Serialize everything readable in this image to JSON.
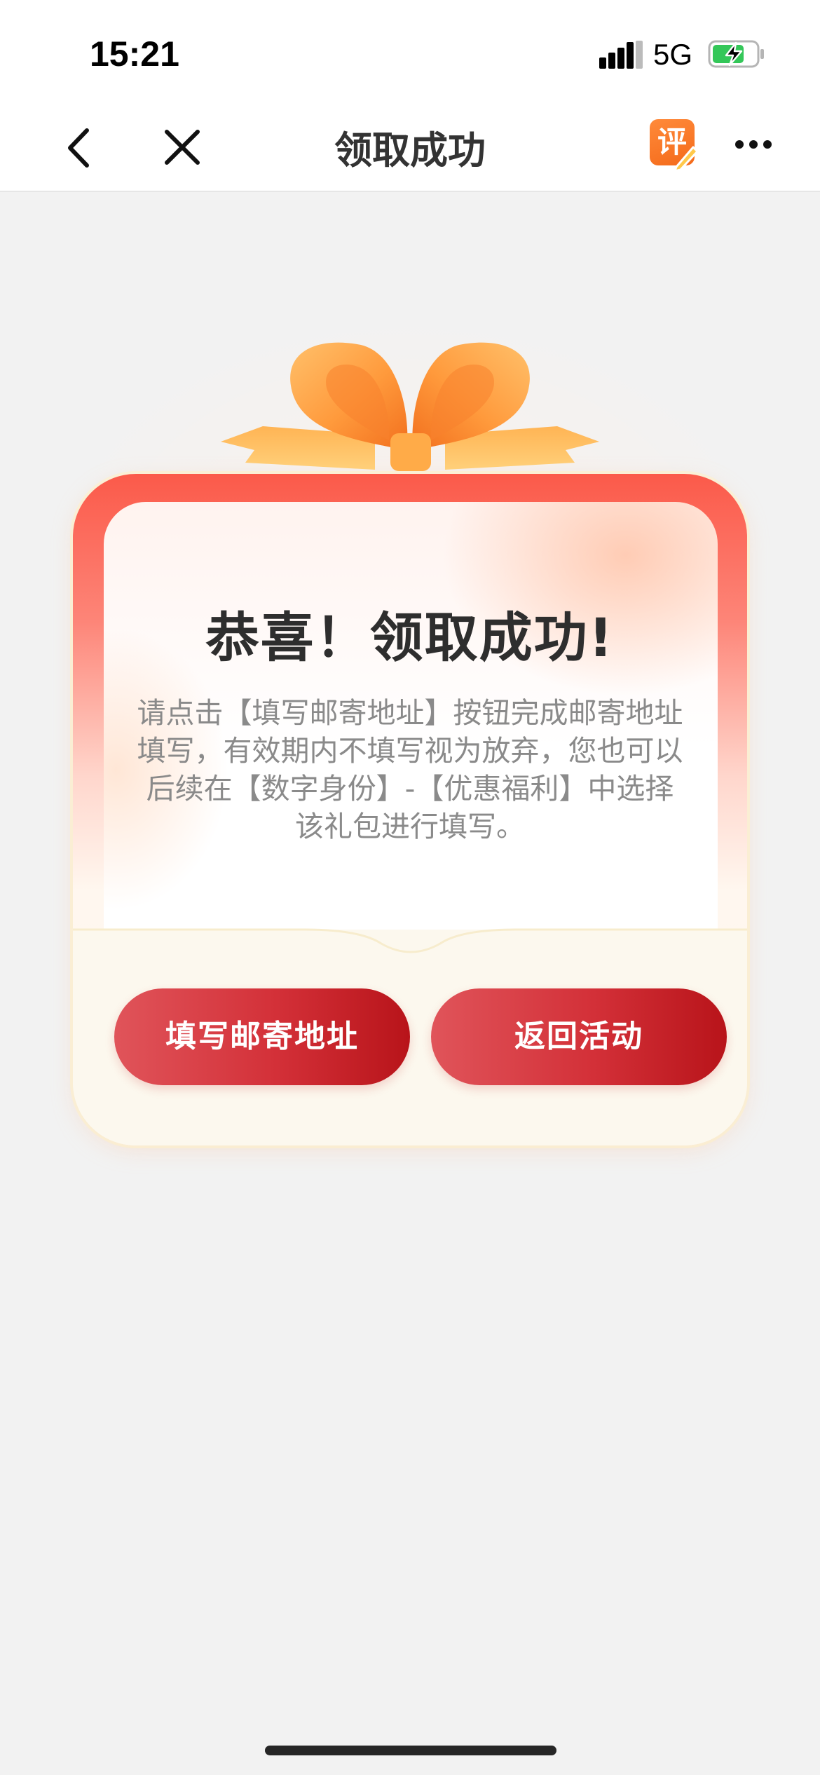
{
  "status_bar": {
    "time": "15:21",
    "network": "5G",
    "signal_icon": "cellular-signal-icon",
    "battery_icon": "battery-charging-icon"
  },
  "nav": {
    "title": "领取成功",
    "review_badge_text": "评",
    "back_icon": "chevron-left-icon",
    "close_icon": "close-icon",
    "more_icon": "more-dots-icon"
  },
  "card": {
    "title": "恭喜！领取成功!",
    "description": "请点击【填写邮寄地址】按钮完成邮寄地址填写，有效期内不填写视为放弃，您也可以后续在【数字身份】-【优惠福利】中选择该礼包进行填写。",
    "primary_button": "填写邮寄地址",
    "secondary_button": "返回活动"
  },
  "colors": {
    "accent_red": "#d33038",
    "ribbon_orange": "#ff9a3c",
    "battery_green": "#34c759",
    "background": "#f2f2f2"
  }
}
